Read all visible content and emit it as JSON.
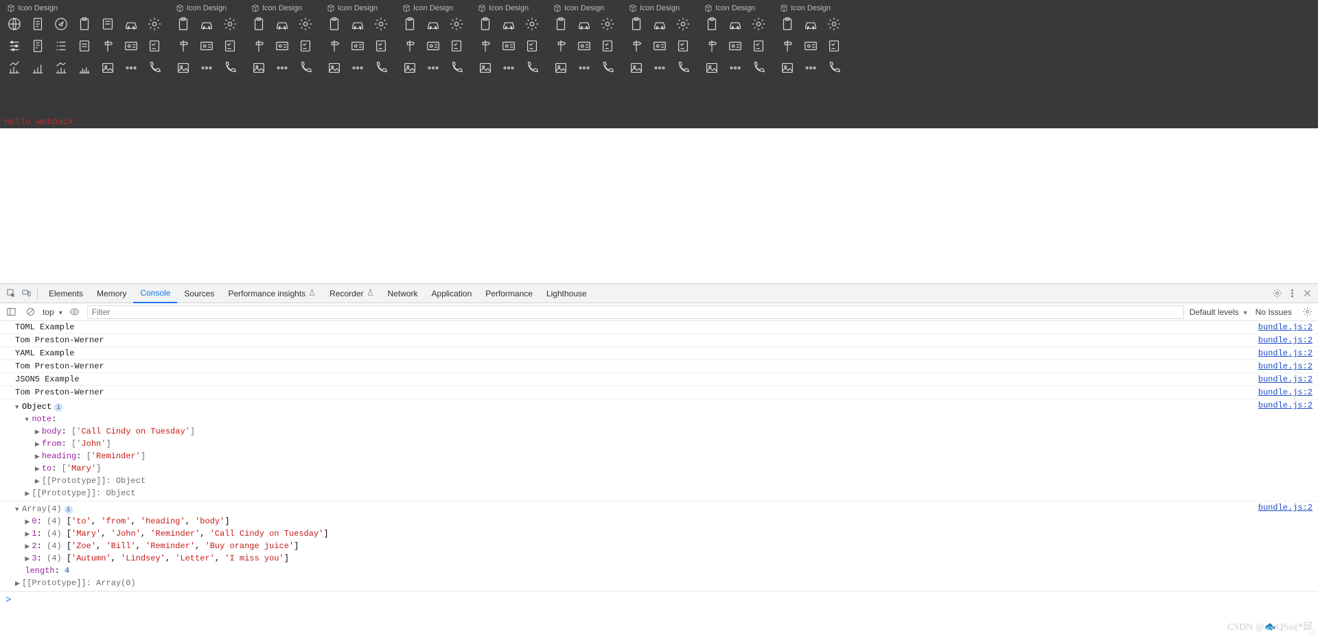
{
  "iconset_title": "Icon Design",
  "hello_text": "Hello webpack",
  "devtools": {
    "tabs": [
      "Elements",
      "Memory",
      "Console",
      "Sources",
      "Performance insights",
      "Recorder",
      "Network",
      "Application",
      "Performance",
      "Lighthouse"
    ],
    "active_tab": "Console",
    "filter_placeholder": "Filter",
    "context_scope": "top",
    "levels_label": "Default levels",
    "issues_label": "No Issues"
  },
  "console": {
    "simple_logs": [
      {
        "msg": "TOML Example",
        "src": "bundle.js:2"
      },
      {
        "msg": "Tom Preston-Werner",
        "src": "bundle.js:2"
      },
      {
        "msg": "YAML Example",
        "src": "bundle.js:2"
      },
      {
        "msg": "Tom Preston-Werner",
        "src": "bundle.js:2"
      },
      {
        "msg": "JSON5 Example",
        "src": "bundle.js:2"
      },
      {
        "msg": "Tom Preston-Werner",
        "src": "bundle.js:2"
      }
    ],
    "src_link": "bundle.js:2",
    "obj_label": "Object",
    "note_key": "note",
    "note_props": [
      {
        "k": "body",
        "v": "['Call Cindy on Tuesday']"
      },
      {
        "k": "from",
        "v": "['John']"
      },
      {
        "k": "heading",
        "v": "['Reminder']"
      },
      {
        "k": "to",
        "v": "['Mary']"
      }
    ],
    "proto_inner": "[[Prototype]]: Object",
    "proto_outer": "[[Prototype]]: Object",
    "array_label": "Array(4)",
    "array_rows": [
      {
        "idx": "0",
        "len": "(4)",
        "items": [
          "'to'",
          "'from'",
          "'heading'",
          "'body'"
        ]
      },
      {
        "idx": "1",
        "len": "(4)",
        "items": [
          "'Mary'",
          "'John'",
          "'Reminder'",
          "'Call Cindy on Tuesday'"
        ]
      },
      {
        "idx": "2",
        "len": "(4)",
        "items": [
          "'Zoe'",
          "'Bill'",
          "'Reminder'",
          "'Buy orange juice'"
        ]
      },
      {
        "idx": "3",
        "len": "(4)",
        "items": [
          "'Autumn'",
          "'Lindsey'",
          "'Letter'",
          "'I miss you'"
        ]
      }
    ],
    "array_length_key": "length",
    "array_length_val": "4",
    "array_proto": "[[Prototype]]: Array(0)",
    "prompt": ">"
  },
  "watermark": "CSDN @🐟QSω[*邱"
}
